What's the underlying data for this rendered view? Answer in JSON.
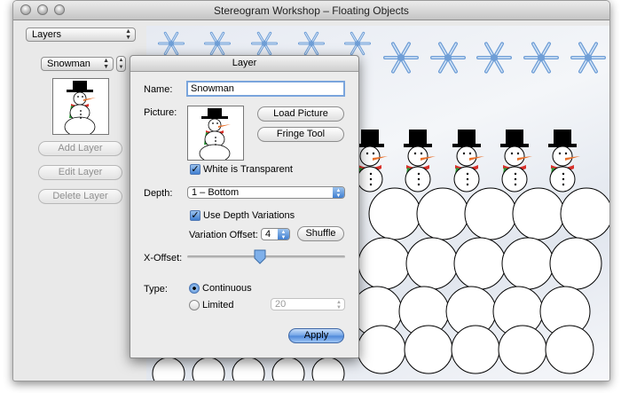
{
  "window": {
    "title": "Stereogram Workshop – Floating Objects"
  },
  "sidebar": {
    "mode_popup": "Layers",
    "layer_popup": "Snowman",
    "add_layer": "Add Layer",
    "edit_layer": "Edit Layer",
    "delete_layer": "Delete Layer"
  },
  "dialog": {
    "title": "Layer",
    "name_label": "Name:",
    "name_value": "Snowman",
    "picture_label": "Picture:",
    "load_picture": "Load Picture",
    "fringe_tool": "Fringe Tool",
    "white_transparent": "White is Transparent",
    "depth_label": "Depth:",
    "depth_value": "1 – Bottom",
    "use_depth_variations": "Use Depth Variations",
    "variation_offset_label": "Variation Offset:",
    "variation_offset_value": "4",
    "shuffle": "Shuffle",
    "x_offset_label": "X-Offset:",
    "x_offset_fraction": 0.46,
    "type_label": "Type:",
    "type_continuous": "Continuous",
    "type_limited": "Limited",
    "limited_value": "20",
    "apply": "Apply"
  },
  "colors": {
    "accent": "#3f7ed0",
    "snowflake": "#6f9ed6",
    "scarf_red": "#d8312b",
    "scarf_green": "#2e9a3a"
  }
}
